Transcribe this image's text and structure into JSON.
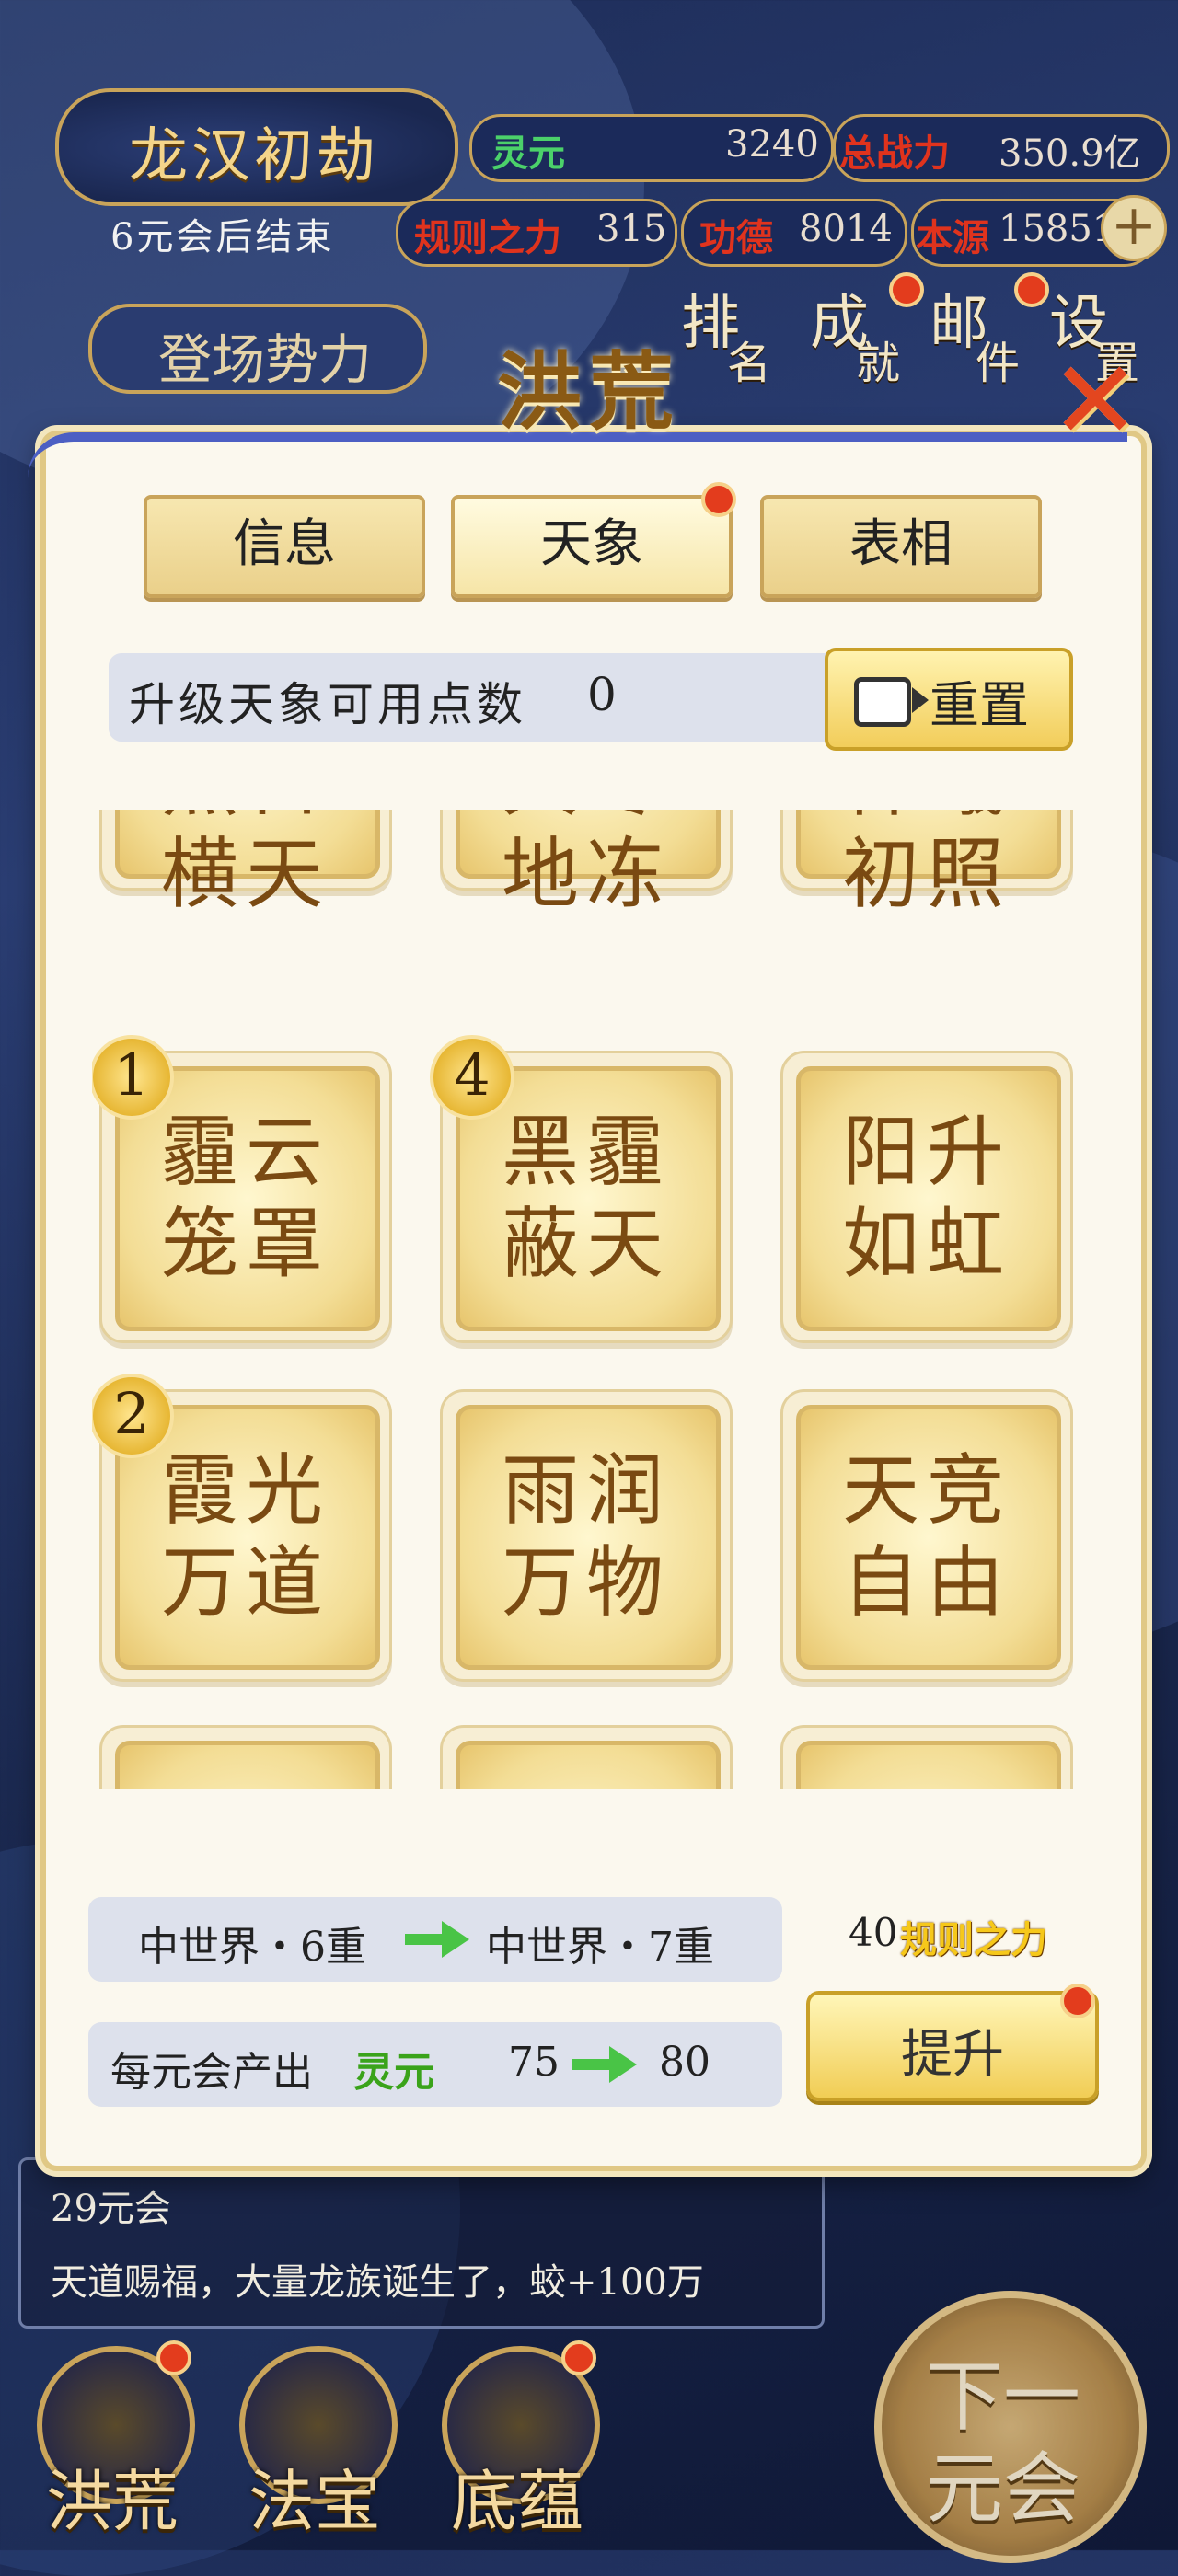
{
  "hud": {
    "title": "龙汉初劫",
    "subtitle": "6元会后结束",
    "stats": {
      "lingyuan_label": "灵元",
      "lingyuan_value": "3240",
      "power_label": "总战力",
      "power_value": "350.9亿",
      "rule_label": "规则之力",
      "rule_value": "315",
      "merit_label": "功德",
      "merit_value": "8014",
      "origin_label": "本源",
      "origin_value": "15851"
    },
    "side_tab": "登场势力",
    "buttons": [
      {
        "c1": "排",
        "c2": "名"
      },
      {
        "c1": "成",
        "c2": "就"
      },
      {
        "c1": "邮",
        "c2": "件"
      },
      {
        "c1": "设",
        "c2": "置"
      }
    ]
  },
  "modal": {
    "title": "洪荒",
    "tabs": [
      "信息",
      "天象",
      "表相"
    ],
    "points_label": "升级天象可用点数",
    "points_value": "0",
    "reset_label": "重置",
    "cards": [
      {
        "line1": "烈日",
        "line2": "横天",
        "badge": ""
      },
      {
        "line1": "大寒",
        "line2": "地冻",
        "badge": ""
      },
      {
        "line1": "神曦",
        "line2": "初照",
        "badge": ""
      },
      {
        "line1": "霾云",
        "line2": "笼罩",
        "badge": "1"
      },
      {
        "line1": "黑霾",
        "line2": "蔽天",
        "badge": "4"
      },
      {
        "line1": "阳升",
        "line2": "如虹",
        "badge": ""
      },
      {
        "line1": "霞光",
        "line2": "万道",
        "badge": "2"
      },
      {
        "line1": "雨润",
        "line2": "万物",
        "badge": ""
      },
      {
        "line1": "天竞",
        "line2": "自由",
        "badge": ""
      },
      {
        "line1": "",
        "line2": "",
        "badge": ""
      },
      {
        "line1": "",
        "line2": "",
        "badge": ""
      },
      {
        "line1": "",
        "line2": "",
        "badge": ""
      }
    ],
    "world_from": "中世界・6重",
    "world_to": "中世界・7重",
    "output_label": "每元会产出",
    "output_resource": "灵元",
    "output_from": "75",
    "output_to": "80",
    "cost_amount": "40",
    "cost_label": "规则之力",
    "upgrade_label": "提升"
  },
  "log": {
    "line1": "29元会",
    "line2": "天道赐福，大量龙族诞生了，蛟+100万"
  },
  "bottom_nav": [
    "洪荒",
    "法宝",
    "底蕴"
  ],
  "next_button": {
    "line1": "下一",
    "line2": "元会"
  }
}
